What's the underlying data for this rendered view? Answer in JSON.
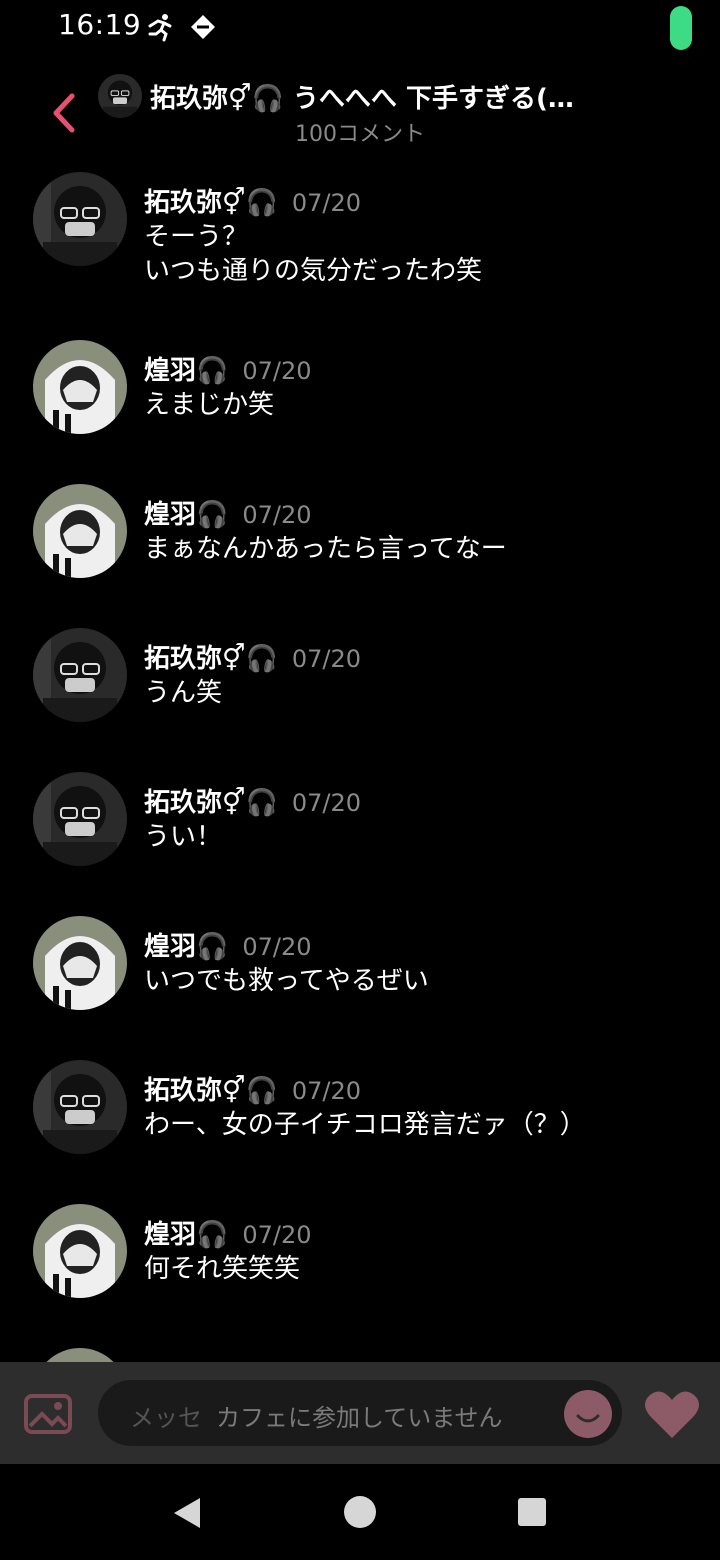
{
  "status_bar": {
    "time": "16:19",
    "icons": [
      "running-icon",
      "sync-icon"
    ],
    "battery_color": "#3ddc84"
  },
  "header": {
    "title": "拓玖弥⚥🎧 うへへへ 下手すぎる(…",
    "subtitle": "100コメント",
    "back_icon": "chevron-left-icon",
    "accent_color": "#e8506e"
  },
  "comments": [
    {
      "author": "拓玖弥⚥🎧",
      "date": "07/20",
      "text": "そーう？\nいつも通りの気分だったわ笑",
      "avatar": "glasses-mask-avatar"
    },
    {
      "author": "煌羽🎧",
      "date": "07/20",
      "text": "えまじか笑",
      "avatar": "hoodie-avatar"
    },
    {
      "author": "煌羽🎧",
      "date": "07/20",
      "text": "まぁなんかあったら言ってなー",
      "avatar": "hoodie-avatar"
    },
    {
      "author": "拓玖弥⚥🎧",
      "date": "07/20",
      "text": "うん笑",
      "avatar": "glasses-mask-avatar"
    },
    {
      "author": "拓玖弥⚥🎧",
      "date": "07/20",
      "text": "うい！",
      "avatar": "glasses-mask-avatar"
    },
    {
      "author": "煌羽🎧",
      "date": "07/20",
      "text": "いつでも救ってやるぜい",
      "avatar": "hoodie-avatar"
    },
    {
      "author": "拓玖弥⚥🎧",
      "date": "07/20",
      "text": "わー、女の子イチコロ発言だァ（？）",
      "avatar": "glasses-mask-avatar"
    },
    {
      "author": "煌羽🎧",
      "date": "07/20",
      "text": "何それ笑笑笑",
      "avatar": "hoodie-avatar"
    }
  ],
  "composer": {
    "placeholder": "メッセ",
    "disabled_notice": "カフェに参加していません",
    "image_icon": "image-icon",
    "emoji_icon": "smile-icon",
    "like_icon": "heart-icon"
  },
  "nav": {
    "back": "back-triangle-icon",
    "home": "home-circle-icon",
    "recents": "recents-square-icon"
  }
}
